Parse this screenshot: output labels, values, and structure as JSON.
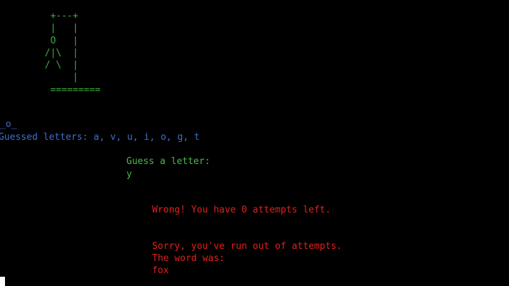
{
  "terminal": {
    "hangman_art": "         +---+\n         |   |\n         O   |\n        /|\\  |\n        / \\  |\n             |\n         =========",
    "word_display": "_o_",
    "guessed_letters": "Guessed letters: a, v, u, i, o, g, t",
    "guess_prompt": "Guess a letter:",
    "guess_input": "y",
    "wrong_message": "Wrong! You have 0 attempts left.",
    "game_over_message": "Sorry, you've run out of attempts.",
    "word_reveal_label": "The word was:",
    "word_answer": "fox"
  },
  "colors": {
    "background": "#000000",
    "art": "#3fae3f",
    "prompt": "#4cb84c",
    "info": "#3f6fc8",
    "error": "#e0201c",
    "cursor": "#ffffff"
  }
}
